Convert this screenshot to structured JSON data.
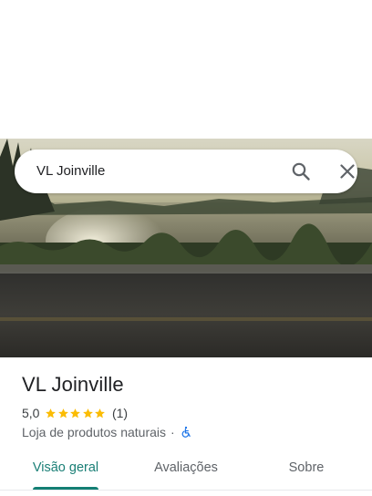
{
  "search": {
    "query": "VL Joinville",
    "search_icon": "search-icon",
    "close_icon": "close-icon"
  },
  "hero": {
    "description_icon": "place-photo"
  },
  "place": {
    "title": "VL Joinville",
    "rating_value": "5,0",
    "rating_stars": 5,
    "rating_count": "(1)",
    "category": "Loja de produtos naturais",
    "separator": "·",
    "accessibility_icon": "wheelchair-icon"
  },
  "tabs": [
    {
      "label": "Visão geral",
      "active": true
    },
    {
      "label": "Avaliações",
      "active": false
    },
    {
      "label": "Sobre",
      "active": false
    }
  ],
  "colors": {
    "accent": "#137f74",
    "star": "#fbbc04",
    "accessibility": "#1a73e8"
  }
}
